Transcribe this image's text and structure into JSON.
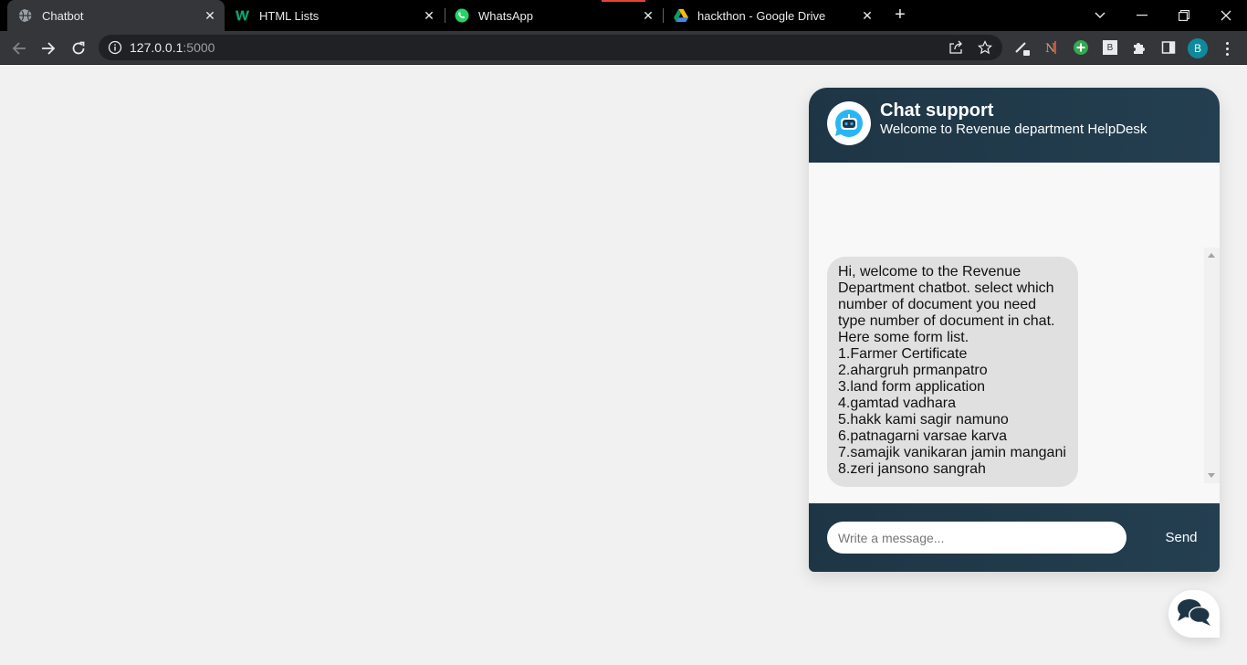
{
  "browser": {
    "tabs": [
      {
        "title": "Chatbot",
        "icon": "globe-icon",
        "active": true
      },
      {
        "title": "HTML Lists",
        "icon": "w3schools-icon",
        "active": false
      },
      {
        "title": "WhatsApp",
        "icon": "whatsapp-icon",
        "active": false
      },
      {
        "title": "hackthon - Google Drive",
        "icon": "google-drive-icon",
        "active": false
      }
    ],
    "url_host": "127.0.0.1",
    "url_port": ":5000",
    "profile_initial": "B",
    "extension_badge": "B",
    "colors": {
      "tabbar": "#000000",
      "toolbar": "#35363a",
      "omnibox": "#202124",
      "avatar": "#0f8a9c"
    }
  },
  "chat": {
    "title": "Chat support",
    "subtitle": "Welcome to Revenue department HelpDesk",
    "bot_avatar_icon": "robot-icon",
    "message_lines": [
      "Hi, welcome to the Revenue",
      "Department chatbot. select which",
      "number of document you need",
      "type number of document in chat.",
      "Here some form list.",
      "1.Farmer Certificate",
      "2.ahargruh prmanpatro",
      "3.land form application",
      "4.gamtad vadhara",
      "5.hakk kami sagir namuno",
      "6.patnagarni varsae karva",
      "7.samajik vanikaran jamin mangani",
      "8.zeri jansono sangrah"
    ],
    "input_placeholder": "Write a message...",
    "input_value": "",
    "send_label": "Send",
    "toggle_icon": "comments-icon",
    "colors": {
      "header": "#1e3545",
      "bubble": "#e0e0e0",
      "page_bg": "#f1f1f1"
    }
  }
}
